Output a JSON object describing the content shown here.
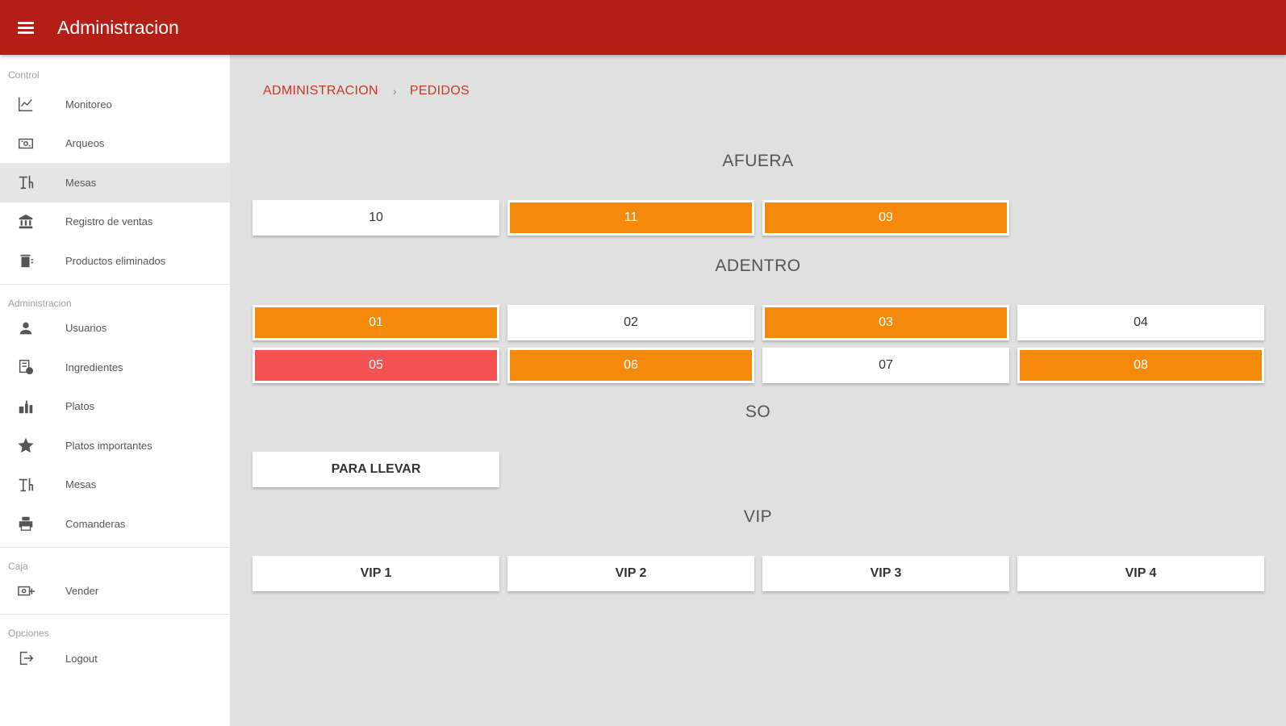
{
  "appbar": {
    "title": "Administracion"
  },
  "sidebar": {
    "sections": [
      {
        "label": "Control",
        "items": [
          {
            "label": "Monitoreo",
            "icon": "line-chart-icon"
          },
          {
            "label": "Arqueos",
            "icon": "cash-register-icon"
          },
          {
            "label": "Mesas",
            "icon": "table-chairs-icon",
            "active": true
          },
          {
            "label": "Registro de ventas",
            "icon": "bank-icon"
          },
          {
            "label": "Productos eliminados",
            "icon": "trash-icon"
          }
        ]
      },
      {
        "label": "Administracion",
        "items": [
          {
            "label": "Usuarios",
            "icon": "person-icon"
          },
          {
            "label": "Ingredientes",
            "icon": "ingredients-icon"
          },
          {
            "label": "Platos",
            "icon": "bottles-icon"
          },
          {
            "label": "Platos importantes",
            "icon": "star-icon"
          },
          {
            "label": "Mesas",
            "icon": "table-chairs-icon"
          },
          {
            "label": "Comanderas",
            "icon": "printer-icon"
          }
        ]
      },
      {
        "label": "Caja",
        "items": [
          {
            "label": "Vender",
            "icon": "cash-add-icon"
          }
        ]
      },
      {
        "label": "Opciones",
        "items": [
          {
            "label": "Logout",
            "icon": "logout-icon"
          }
        ]
      }
    ]
  },
  "breadcrumb": {
    "root": "ADMINISTRACION",
    "separator": "›",
    "current": "PEDIDOS"
  },
  "areas": [
    {
      "title": "AFUERA",
      "rows": [
        [
          {
            "label": "10",
            "status": "free"
          },
          {
            "label": "11",
            "status": "busy"
          },
          {
            "label": "09",
            "status": "busy"
          }
        ]
      ]
    },
    {
      "title": "ADENTRO",
      "rows": [
        [
          {
            "label": "01",
            "status": "busy"
          },
          {
            "label": "02",
            "status": "free"
          },
          {
            "label": "03",
            "status": "busy"
          },
          {
            "label": "04",
            "status": "free"
          }
        ],
        [
          {
            "label": "05",
            "status": "alert"
          },
          {
            "label": "06",
            "status": "busy"
          },
          {
            "label": "07",
            "status": "free"
          },
          {
            "label": "08",
            "status": "busy"
          }
        ]
      ]
    },
    {
      "title": "SO",
      "rows": [
        [
          {
            "label": "PARA LLEVAR",
            "status": "free",
            "bold": true
          }
        ]
      ]
    },
    {
      "title": "VIP",
      "rows": [
        [
          {
            "label": "VIP 1",
            "status": "free",
            "bold": true
          },
          {
            "label": "VIP 2",
            "status": "free",
            "bold": true
          },
          {
            "label": "VIP 3",
            "status": "free",
            "bold": true
          },
          {
            "label": "VIP 4",
            "status": "free",
            "bold": true
          }
        ]
      ]
    }
  ],
  "colors": {
    "appbar": "#b31f17",
    "busy": "#f5890b",
    "alert": "#f45252",
    "breadcrumb": "#c0392b"
  }
}
